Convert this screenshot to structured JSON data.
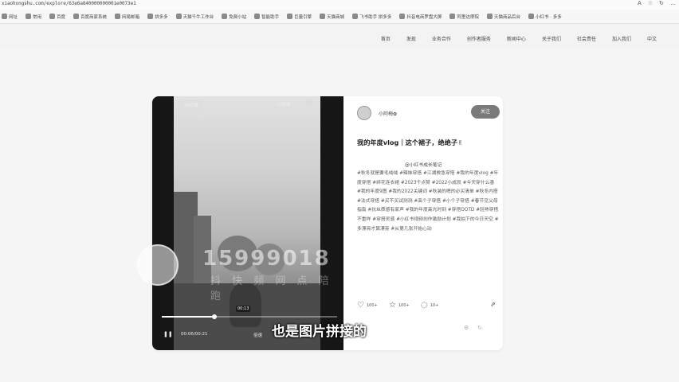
{
  "browser": {
    "url": "xiaohongshu.com/explore/63e6a840000000001e0073e1",
    "icons": [
      "A",
      "☆",
      "↻",
      "…"
    ]
  },
  "bookmarks": [
    "网址",
    "常用",
    "百度",
    "百度商家系统",
    "网易邮箱",
    "拼多多",
    "天猫千牛工作台",
    "免费小站",
    "智能助手",
    "巨量引擎",
    "天猫商城",
    "飞书助手 拼多多",
    "抖音电商罗盘大屏",
    "阿里达摩院",
    "天猫商品后台",
    "小红书 · 多多"
  ],
  "site_nav": [
    "首页",
    "发现",
    "业务合作",
    "创作者服务",
    "新闻中心",
    "关于我们",
    "社会责任",
    "加入我们",
    "中文"
  ],
  "video": {
    "top_badge": "小红书",
    "top_name": "小阿梅",
    "progress_fraction": 0.3,
    "time_tooltip": "00:13",
    "pause_icon": "❚❚",
    "time": "00:06/00:21",
    "speed": "倍速"
  },
  "side": {
    "author_name": "小阿梅✿",
    "follow_label": "关注",
    "title": "我的年度vlog｜这个裙子，绝绝子✌",
    "source": "@小红书成长笔记",
    "tags": "#秋冬就是要毛绒绒 #辣妹穿搭 #江湖救急穿搭 #我的年度vlog #年度穿搭 #碎花连衣裙 #2023千点赞 #2022小成就 #今天穿什么香 #我的年度9图 #我的2022关键词 #秋装的嗯的必买清单 #秋冬内搭 #法式穿搭 #买不买试测测 #高个子穿搭 #小个子穿搭 #春节见父母指南 #抗丝质感有家声 #我的年度高光时刻 #穿搭OOTD #轻熟穿搭不重样 #穿搭灵感 #小红书视频创作激励计划 #我拍下的今日天空 #多漂亮才算漂亮 #从第几张开始心动",
    "like_count": "100+",
    "collect_count": "100+",
    "comment_count": "10+"
  },
  "watermark": {
    "number": "15999018",
    "text": "抖 快 频 网 点 陪 跑"
  },
  "subtitle": "也是图片拼接的"
}
